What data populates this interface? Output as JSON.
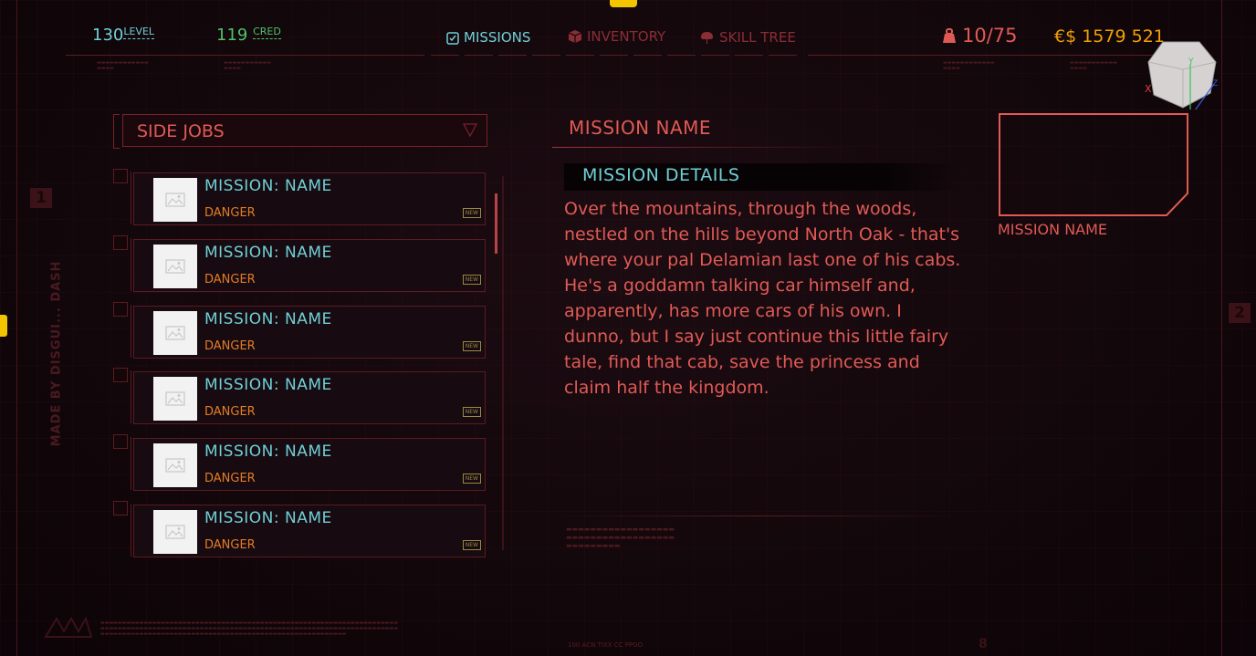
{
  "header": {
    "level_value": "130",
    "level_label": "LEVEL",
    "cred_value": "119",
    "cred_label": "CRED",
    "tabs": [
      {
        "label": "MISSIONS",
        "icon": "clipboard-check-icon",
        "active": true
      },
      {
        "label": "INVENTORY",
        "icon": "cube-icon",
        "active": false
      },
      {
        "label": "SKILL TREE",
        "icon": "brain-icon",
        "active": false
      }
    ],
    "weight": "10/75",
    "weight_icon": "weight-icon",
    "money": "€$ 1579 521"
  },
  "side_markers": {
    "left": "1",
    "right": "2",
    "vertical_text": "MADE BY DISGUI... DASH",
    "corner": "8"
  },
  "dropdown": {
    "label": "SIDE JOBS"
  },
  "missions": [
    {
      "name": "MISSION: NAME",
      "danger": "DANGER",
      "badge": "NEW"
    },
    {
      "name": "MISSION: NAME",
      "danger": "DANGER",
      "badge": "NEW"
    },
    {
      "name": "MISSION: NAME",
      "danger": "DANGER",
      "badge": "NEW"
    },
    {
      "name": "MISSION: NAME",
      "danger": "DANGER",
      "badge": "NEW"
    },
    {
      "name": "MISSION: NAME",
      "danger": "DANGER",
      "badge": "NEW"
    },
    {
      "name": "MISSION: NAME",
      "danger": "DANGER",
      "badge": "NEW"
    }
  ],
  "details": {
    "title": "MISSION NAME",
    "section": "MISSION DETAILS",
    "description": "Over the mountains, through the woods, nestled on the hills beyond North Oak - that's where your pal Delamian last one of his cabs. He's a goddamn talking car himself and, apparently, has more cars of his own. I dunno, but I say just continue this little fairy tale, find that cab, save the princess and claim half the kingdom.",
    "preview_label": "MISSION NAME"
  },
  "footer": {
    "code": "100 ACN TIXX CC PPGO"
  },
  "colors": {
    "cyan": "#6fd0d6",
    "red": "#e05a55",
    "orange": "#e37d26",
    "gold": "#f0a000",
    "yellow": "#f2c500"
  }
}
